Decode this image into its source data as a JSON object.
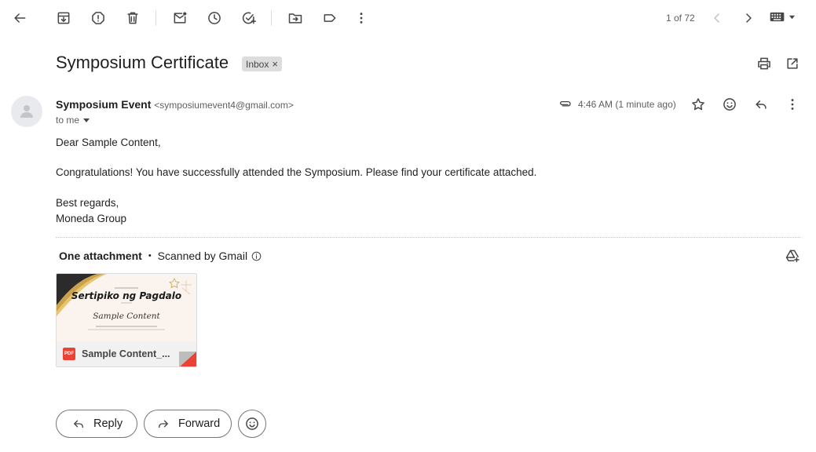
{
  "toolbar": {
    "back": "arrow-back-icon",
    "archive": "archive-icon",
    "report_spam": "report-spam-icon",
    "delete": "trash-icon",
    "mark_unread": "mark-unread-icon",
    "snooze": "clock-icon",
    "add_task": "add-task-icon",
    "move_to": "move-to-icon",
    "labels": "label-icon",
    "more": "more-vert-icon",
    "pager_text": "1 of 72"
  },
  "email": {
    "subject": "Symposium Certificate",
    "label_badge": "Inbox",
    "label_remove": "×",
    "sender_name": "Symposium Event",
    "sender_email": "<symposiumevent4@gmail.com>",
    "to_me": "to me",
    "time": "4:46 AM (1 minute ago)",
    "body": {
      "greeting": "Dear Sample Content,",
      "paragraph": "Congratulations! You have successfully attended the Symposium. Please find your certificate attached.",
      "closing": "Best regards,",
      "signature": "Moneda Group"
    }
  },
  "attachments": {
    "heading": "One attachment",
    "separator": "•",
    "scanned": "Scanned by Gmail",
    "file_badge": "PDF",
    "file_name": "Sample Content_...",
    "preview": {
      "title": "Sertipiko ng Pagdalo",
      "name": "Sample Content"
    }
  },
  "actions": {
    "reply_label": "Reply",
    "forward_label": "Forward"
  },
  "colors": {
    "pdf_red": "#ea4335",
    "icon_gray": "#444746",
    "badge_bg": "#dddddd"
  }
}
